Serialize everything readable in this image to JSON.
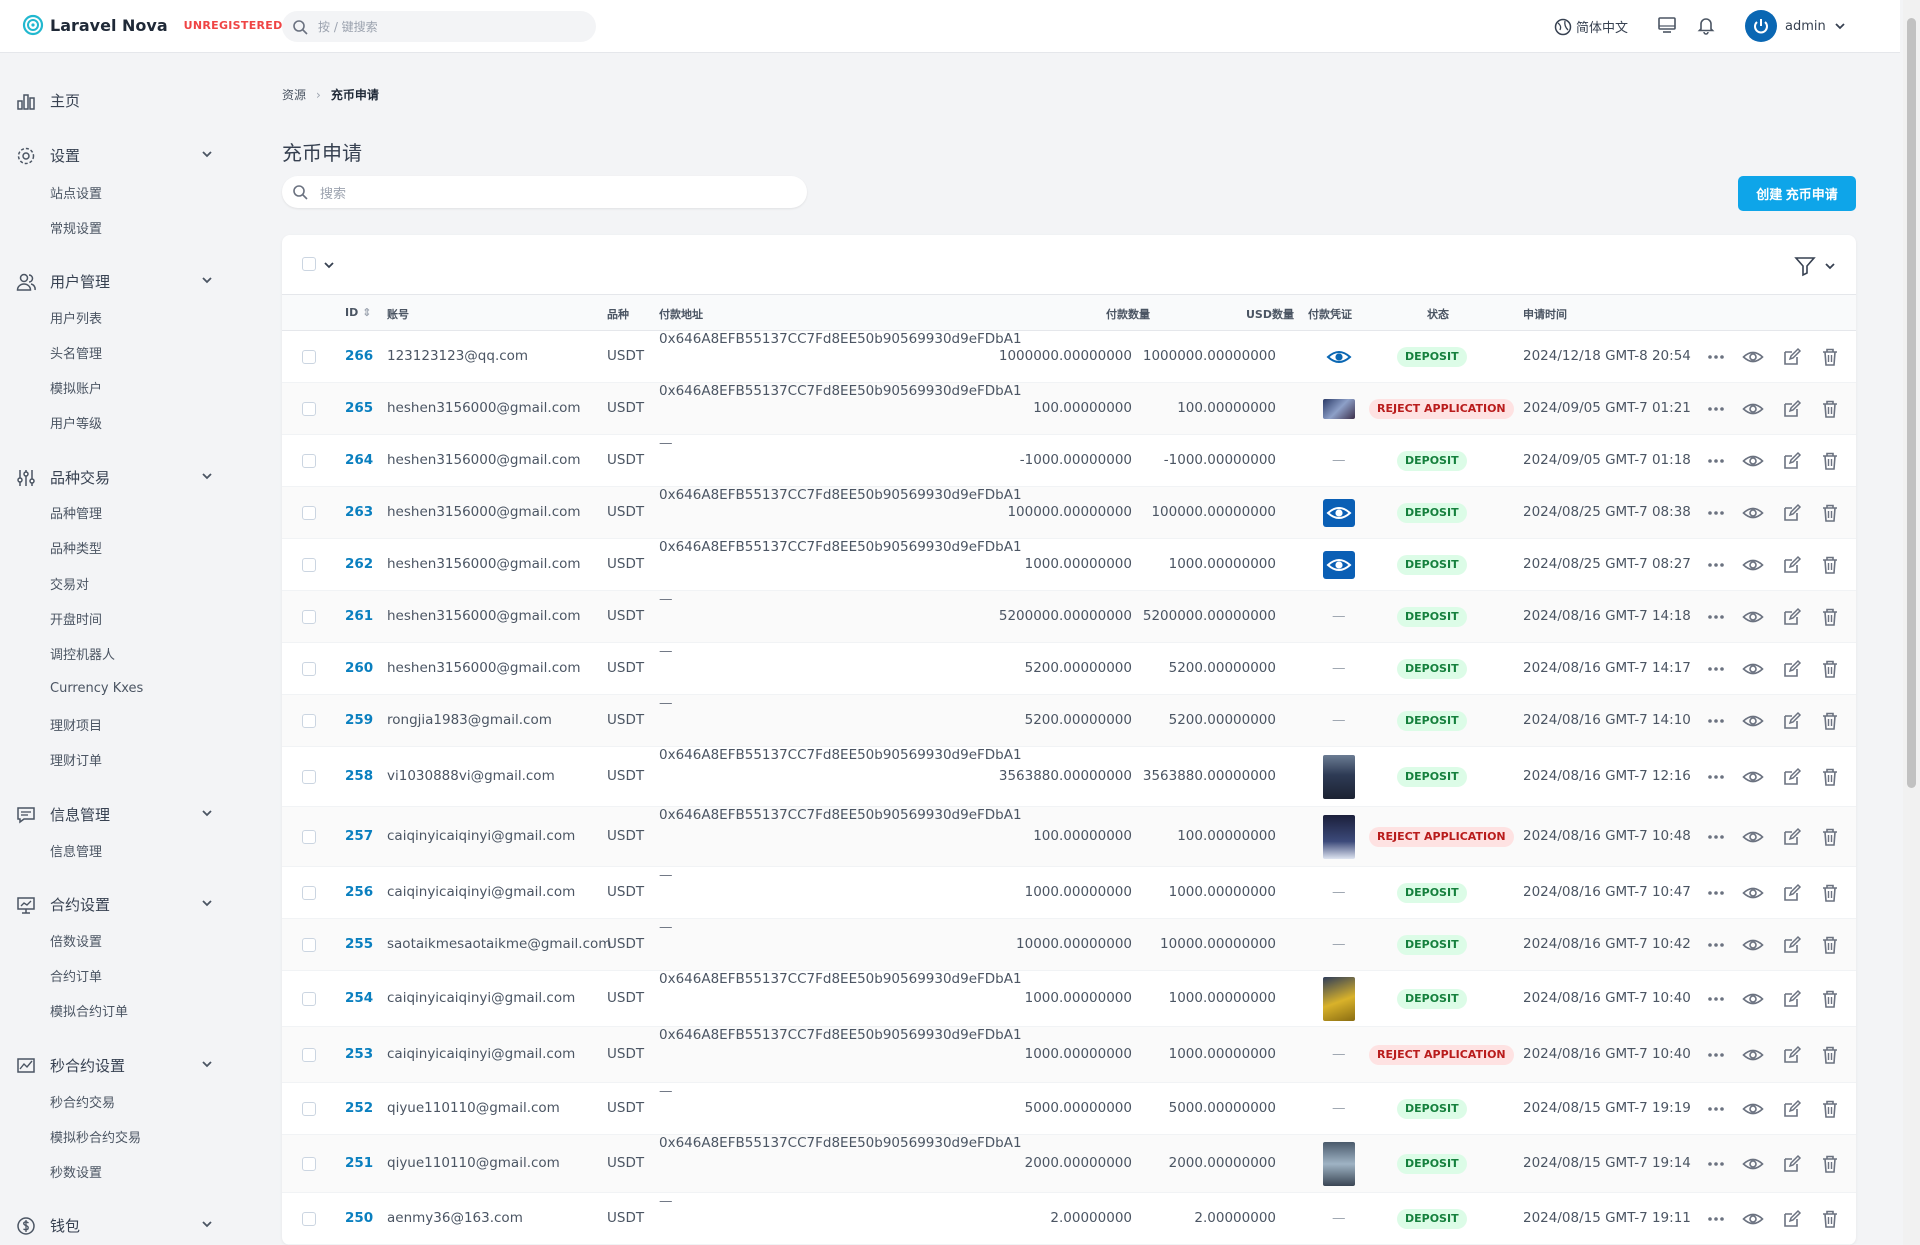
{
  "header": {
    "brand": "Laravel Nova",
    "unregistered": "UNREGISTERED",
    "search_placeholder": "按 / 键搜索",
    "language": "简体中文",
    "user": "admin"
  },
  "sidebar": {
    "home": "主页",
    "groups": [
      {
        "label": "设置",
        "items": [
          "站点设置",
          "常规设置"
        ]
      },
      {
        "label": "用户管理",
        "items": [
          "用户列表",
          "头名管理",
          "模拟账户",
          "用户等级"
        ]
      },
      {
        "label": "品种交易",
        "items": [
          "品种管理",
          "品种类型",
          "交易对",
          "开盘时间",
          "调控机器人",
          "Currency Kxes",
          "理财项目",
          "理财订单"
        ]
      },
      {
        "label": "信息管理",
        "items": [
          "信息管理"
        ]
      },
      {
        "label": "合约设置",
        "items": [
          "倍数设置",
          "合约订单",
          "模拟合约订单"
        ]
      },
      {
        "label": "秒合约设置",
        "items": [
          "秒合约交易",
          "模拟秒合约交易",
          "秒数设置"
        ]
      },
      {
        "label": "钱包",
        "items": []
      }
    ]
  },
  "breadcrumb": {
    "root": "资源",
    "current": "充币申请"
  },
  "page": {
    "title": "充币申请",
    "search_placeholder": "搜索",
    "create_button": "创建 充币申请"
  },
  "table": {
    "columns": {
      "id": "ID",
      "account": "账号",
      "currency": "品种",
      "address": "付款地址",
      "amount": "付款数量",
      "usd": "USD数量",
      "proof": "付款凭证",
      "status": "状态",
      "time": "申请时间"
    },
    "rows": [
      {
        "id": "266",
        "account": "123123123@qq.com",
        "currency": "USDT",
        "address": "0x646A8EFB55137CC7Fd8EE50b90569930d9eFDbA1",
        "amount": "1000000.00000000",
        "usd": "1000000.00000000",
        "proof": "eye",
        "status": "DEPOSIT",
        "time": "2024/12/18 GMT-8 20:54"
      },
      {
        "id": "265",
        "account": "heshen3156000@gmail.com",
        "currency": "USDT",
        "address": "0x646A8EFB55137CC7Fd8EE50b90569930d9eFDbA1",
        "amount": "100.00000000",
        "usd": "100.00000000",
        "proof": "image",
        "status": "REJECT APPLICATION",
        "time": "2024/09/05 GMT-7 01:21"
      },
      {
        "id": "264",
        "account": "heshen3156000@gmail.com",
        "currency": "USDT",
        "address": "—",
        "amount": "-1000.00000000",
        "usd": "-1000.00000000",
        "proof": "none",
        "status": "DEPOSIT",
        "time": "2024/09/05 GMT-7 01:18"
      },
      {
        "id": "263",
        "account": "heshen3156000@gmail.com",
        "currency": "USDT",
        "address": "0x646A8EFB55137CC7Fd8EE50b90569930d9eFDbA1",
        "amount": "100000.00000000",
        "usd": "100000.00000000",
        "proof": "eye-solid",
        "status": "DEPOSIT",
        "time": "2024/08/25 GMT-7 08:38"
      },
      {
        "id": "262",
        "account": "heshen3156000@gmail.com",
        "currency": "USDT",
        "address": "0x646A8EFB55137CC7Fd8EE50b90569930d9eFDbA1",
        "amount": "1000.00000000",
        "usd": "1000.00000000",
        "proof": "eye-solid",
        "status": "DEPOSIT",
        "time": "2024/08/25 GMT-7 08:27"
      },
      {
        "id": "261",
        "account": "heshen3156000@gmail.com",
        "currency": "USDT",
        "address": "—",
        "amount": "5200000.00000000",
        "usd": "5200000.00000000",
        "proof": "none",
        "status": "DEPOSIT",
        "time": "2024/08/16 GMT-7 14:18"
      },
      {
        "id": "260",
        "account": "heshen3156000@gmail.com",
        "currency": "USDT",
        "address": "—",
        "amount": "5200.00000000",
        "usd": "5200.00000000",
        "proof": "none",
        "status": "DEPOSIT",
        "time": "2024/08/16 GMT-7 14:17"
      },
      {
        "id": "259",
        "account": "rongjia1983@gmail.com",
        "currency": "USDT",
        "address": "—",
        "amount": "5200.00000000",
        "usd": "5200.00000000",
        "proof": "none",
        "status": "DEPOSIT",
        "time": "2024/08/16 GMT-7 14:10"
      },
      {
        "id": "258",
        "account": "vi1030888vi@gmail.com",
        "currency": "USDT",
        "address": "0x646A8EFB55137CC7Fd8EE50b90569930d9eFDbA1",
        "amount": "3563880.00000000",
        "usd": "3563880.00000000",
        "proof": "image-tall",
        "status": "DEPOSIT",
        "time": "2024/08/16 GMT-7 12:16"
      },
      {
        "id": "257",
        "account": "caiqinyicaiqinyi@gmail.com",
        "currency": "USDT",
        "address": "0x646A8EFB55137CC7Fd8EE50b90569930d9eFDbA1",
        "amount": "100.00000000",
        "usd": "100.00000000",
        "proof": "image-dark",
        "status": "REJECT APPLICATION",
        "time": "2024/08/16 GMT-7 10:48"
      },
      {
        "id": "256",
        "account": "caiqinyicaiqinyi@gmail.com",
        "currency": "USDT",
        "address": "—",
        "amount": "1000.00000000",
        "usd": "1000.00000000",
        "proof": "none",
        "status": "DEPOSIT",
        "time": "2024/08/16 GMT-7 10:47"
      },
      {
        "id": "255",
        "account": "saotaikmesaotaikme@gmail.com",
        "currency": "USDT",
        "address": "—",
        "amount": "10000.00000000",
        "usd": "10000.00000000",
        "proof": "none",
        "status": "DEPOSIT",
        "time": "2024/08/16 GMT-7 10:42"
      },
      {
        "id": "254",
        "account": "caiqinyicaiqinyi@gmail.com",
        "currency": "USDT",
        "address": "0x646A8EFB55137CC7Fd8EE50b90569930d9eFDbA1",
        "amount": "1000.00000000",
        "usd": "1000.00000000",
        "proof": "image-yellow",
        "status": "DEPOSIT",
        "time": "2024/08/16 GMT-7 10:40"
      },
      {
        "id": "253",
        "account": "caiqinyicaiqinyi@gmail.com",
        "currency": "USDT",
        "address": "0x646A8EFB55137CC7Fd8EE50b90569930d9eFDbA1",
        "amount": "1000.00000000",
        "usd": "1000.00000000",
        "proof": "none",
        "status": "REJECT APPLICATION",
        "time": "2024/08/16 GMT-7 10:40"
      },
      {
        "id": "252",
        "account": "qiyue110110@gmail.com",
        "currency": "USDT",
        "address": "—",
        "amount": "5000.00000000",
        "usd": "5000.00000000",
        "proof": "none",
        "status": "DEPOSIT",
        "time": "2024/08/15 GMT-7 19:19"
      },
      {
        "id": "251",
        "account": "qiyue110110@gmail.com",
        "currency": "USDT",
        "address": "0x646A8EFB55137CC7Fd8EE50b90569930d9eFDbA1",
        "amount": "2000.00000000",
        "usd": "2000.00000000",
        "proof": "image-phone",
        "status": "DEPOSIT",
        "time": "2024/08/15 GMT-7 19:14"
      },
      {
        "id": "250",
        "account": "aenmy36@163.com",
        "currency": "USDT",
        "address": "—",
        "amount": "2.00000000",
        "usd": "2.00000000",
        "proof": "none",
        "status": "DEPOSIT",
        "time": "2024/08/15 GMT-7 19:11"
      }
    ]
  },
  "colors": {
    "accent": "#0ea5e9",
    "link": "#0a7fbf",
    "deposit_bg": "#dcfce7",
    "deposit_fg": "#15803d",
    "reject_bg": "#fee2e2",
    "reject_fg": "#b91c1c"
  }
}
